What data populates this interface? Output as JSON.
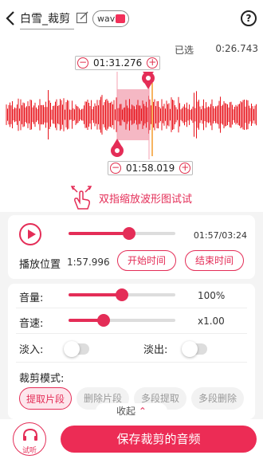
{
  "header": {
    "title": "白雪_裁剪",
    "format": "wav",
    "back_icon": "back-arrow-icon",
    "edit_icon": "edit-icon",
    "help_icon": "help-icon",
    "help_text": "?"
  },
  "selection": {
    "label": "已选",
    "duration": "0:26.743",
    "start_time": "01:31.276",
    "end_time": "01:58.019",
    "minus": "−",
    "plus": "+"
  },
  "hint": {
    "text": "双指缩放波形图试试",
    "icon": "pinch-gesture-icon"
  },
  "playback": {
    "position_text": "01:57/03:24",
    "progress": 0.57,
    "position_label": "播放位置",
    "position_value": "1:57.996",
    "set_start_button": "开始时间",
    "set_end_button": "结束时间"
  },
  "settings": {
    "volume_label": "音量:",
    "volume_value": "100%",
    "volume_level": 0.5,
    "speed_label": "音速:",
    "speed_value": "x1.00",
    "speed_level": 0.33,
    "fade_in_label": "淡入:",
    "fade_out_label": "淡出:",
    "mode_label": "裁剪模式:",
    "modes": [
      "提取片段",
      "删除片段",
      "多段提取",
      "多段删除"
    ]
  },
  "collapse_label": "收起",
  "footer": {
    "listen_label": "试听",
    "save_label": "保存裁剪的音频"
  },
  "colors": {
    "accent": "#e42d57",
    "waveform": "#e8141c",
    "selection": "#f5b8c4",
    "playhead": "#f39a2a"
  }
}
